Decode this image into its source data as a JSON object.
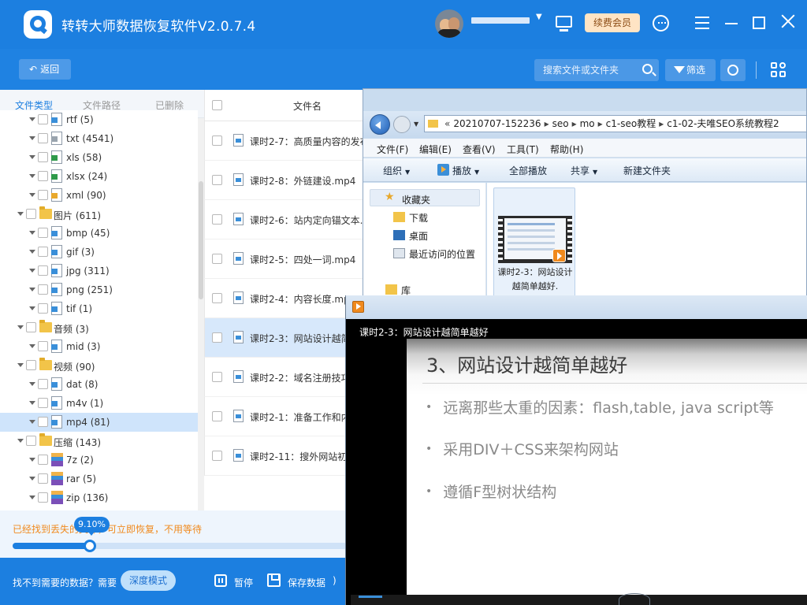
{
  "app": {
    "title": "转转大师数据恢复软件V2.0.7.4",
    "vip_label": "续费会员"
  },
  "toolbar": {
    "back_label": "返回",
    "search_placeholder": "搜索文件或文件夹",
    "filter_label": "筛选"
  },
  "left_tabs": [
    "文件类型",
    "文件路径",
    "已删除"
  ],
  "tree": [
    {
      "label": "rtf (5)",
      "level": 2,
      "icon": "doc-file-icon"
    },
    {
      "label": "txt (4541)",
      "level": 2,
      "icon": "txt-file-icon"
    },
    {
      "label": "xls (58)",
      "level": 2,
      "icon": "xls-file-icon"
    },
    {
      "label": "xlsx (24)",
      "level": 2,
      "icon": "xlsx-file-icon"
    },
    {
      "label": "xml (90)",
      "level": 2,
      "icon": "xml-file-icon"
    },
    {
      "label": "图片 (611)",
      "level": 1,
      "icon": "folder-icon"
    },
    {
      "label": "bmp (45)",
      "level": 2,
      "icon": "image-file-icon"
    },
    {
      "label": "gif (3)",
      "level": 2,
      "icon": "image-file-icon"
    },
    {
      "label": "jpg (311)",
      "level": 2,
      "icon": "image-file-icon"
    },
    {
      "label": "png (251)",
      "level": 2,
      "icon": "image-file-icon"
    },
    {
      "label": "tif (1)",
      "level": 2,
      "icon": "image-file-icon"
    },
    {
      "label": "音频 (3)",
      "level": 1,
      "icon": "folder-icon"
    },
    {
      "label": "mid (3)",
      "level": 2,
      "icon": "audio-file-icon"
    },
    {
      "label": "视频 (90)",
      "level": 1,
      "icon": "folder-icon"
    },
    {
      "label": "dat (8)",
      "level": 2,
      "icon": "video-file-icon"
    },
    {
      "label": "m4v (1)",
      "level": 2,
      "icon": "video-file-icon"
    },
    {
      "label": "mp4 (81)",
      "level": 2,
      "icon": "video-file-icon",
      "selected": true
    },
    {
      "label": "压缩 (143)",
      "level": 1,
      "icon": "folder-icon"
    },
    {
      "label": "7z (2)",
      "level": 2,
      "icon": "archive-file-icon"
    },
    {
      "label": "rar (5)",
      "level": 2,
      "icon": "archive-file-icon"
    },
    {
      "label": "zip (136)",
      "level": 2,
      "icon": "archive-file-icon"
    }
  ],
  "progress": {
    "text": "已经找到丢失的文件，可立即恢复，不用等待",
    "percent_label": "9.10%",
    "fraction": 0.232
  },
  "bottom_bar": {
    "not_found": "找不到需要的数据？需要",
    "deep_mode": "深度模式",
    "pause": "暂停",
    "save": "保存数据"
  },
  "file_list": {
    "header_name": "文件名",
    "rows": [
      {
        "name": "课时2-7：高质量内容的发布.mp4"
      },
      {
        "name": "课时2-8：外链建设.mp4"
      },
      {
        "name": "课时2-6：站内定向锚文本.mp4"
      },
      {
        "name": "课时2-5：四处一词.mp4"
      },
      {
        "name": "课时2-4：内容长度.mp4"
      },
      {
        "name": "课时2-3：网站设计越简单越好.mp4",
        "selected": true
      },
      {
        "name": "课时2-2：域名注册技巧.mp4"
      },
      {
        "name": "课时2-1：准备工作和内容.mp4"
      },
      {
        "name": "课时2-11：搜外网站初.mp4"
      }
    ]
  },
  "explorer": {
    "address": [
      "20210707-152236",
      "seo",
      "mo",
      "c1-seo教程",
      "c1-02-夫唯SEO系统教程2"
    ],
    "menu": [
      "文件(F)",
      "编辑(E)",
      "查看(V)",
      "工具(T)",
      "帮助(H)"
    ],
    "commands": {
      "organize": "组织",
      "play": "播放",
      "play_all": "全部播放",
      "share": "共享",
      "new_folder": "新建文件夹"
    },
    "nav": {
      "favorites": "收藏夹",
      "downloads": "下载",
      "desktop": "桌面",
      "recent": "最近访问的位置",
      "library": "库"
    },
    "thumbnail_label": "课时2-3：网站设计越简单越好."
  },
  "player": {
    "video_title": "课时2-3：网站设计越简单越好",
    "slide_title": "3、网站设计越简单越好",
    "bullets": [
      "远离那些太重的因素：flash,table, java script等",
      "采用DIV＋CSS来架构网站",
      "遵循F型树状结构"
    ]
  },
  "colors": {
    "brand": "#1c7fe0",
    "vip_bg": "#ffe4c4",
    "progress_text": "#f08a1e",
    "selection": "#cfe4fb"
  }
}
